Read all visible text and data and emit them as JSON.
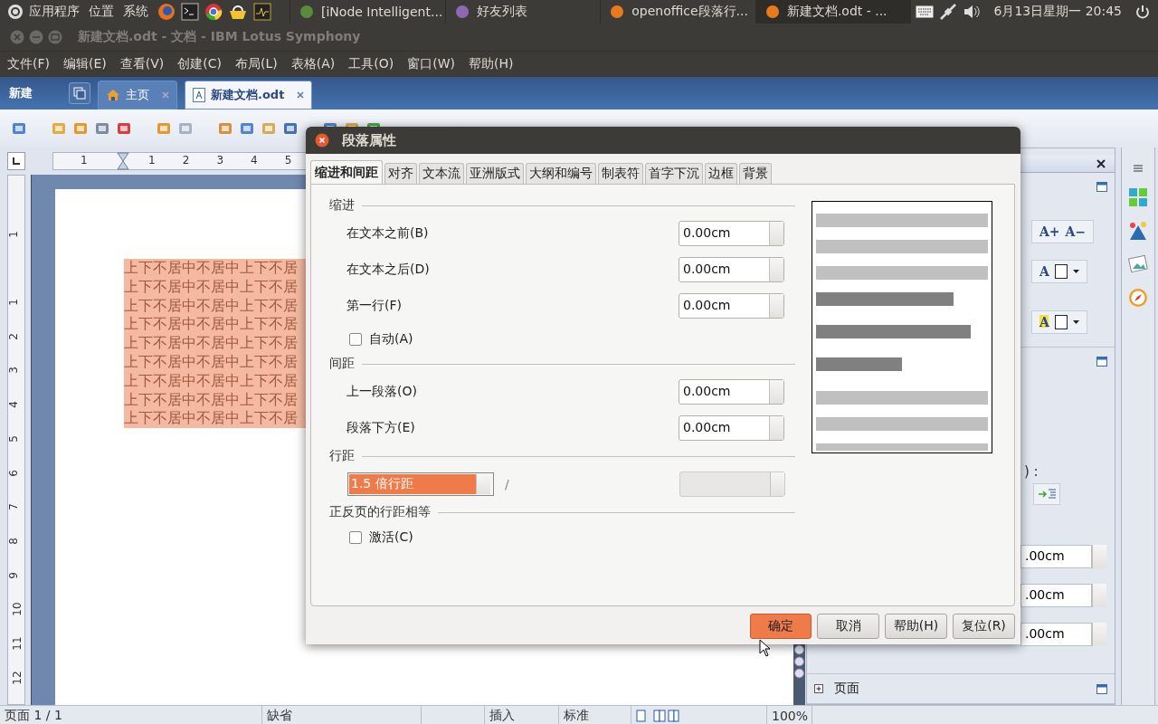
{
  "top_panel": {
    "menus": [
      "应用程序",
      "位置",
      "系统"
    ],
    "tasks": [
      {
        "label": "[iNode Intelligent...",
        "selected": false
      },
      {
        "label": "好友列表",
        "selected": false
      },
      {
        "label": "openoffice段落行...",
        "selected": false
      },
      {
        "label": "新建文档.odt - ...",
        "selected": true
      }
    ],
    "clock": "6月13日星期一 20:45"
  },
  "window": {
    "title": "新建文档.odt - 文档 - IBM Lotus Symphony"
  },
  "menu": [
    "文件(F)",
    "编辑(E)",
    "查看(V)",
    "创建(C)",
    "布局(L)",
    "表格(A)",
    "工具(O)",
    "窗口(W)",
    "帮助(H)"
  ],
  "doc_tabs": {
    "new_label": "新建",
    "tabs": [
      {
        "label": "主页",
        "selected": false
      },
      {
        "label": "新建文档.odt",
        "selected": true
      }
    ]
  },
  "ruler": {
    "horizontal": [
      "1",
      "1",
      "2",
      "3",
      "4",
      "5"
    ],
    "vertical": [
      "1",
      "1",
      "2",
      "3",
      "4",
      "5",
      "6",
      "7",
      "8",
      "9",
      "10",
      "11",
      "12"
    ]
  },
  "document": {
    "lines": [
      "上下不居中不居中上下不居",
      "上下不居中不居中上下不居",
      "上下不居中不居中上下不居",
      "上下不居中不居中上下不居",
      "上下不居中不居中上下不居",
      "上下不居中不居中上下不居",
      "上下不居中不居中上下不居",
      "上下不居中不居中上下不居",
      "上下不居中不居中上下不居"
    ]
  },
  "sidebar": {
    "label_fragment": ") :",
    "grow": "A+",
    "shrink": "A−",
    "font_color": "A",
    "highlight": "A",
    "fields": [
      ".00cm",
      ".00cm",
      ".00cm"
    ],
    "section": "页面"
  },
  "dialog": {
    "title": "段落属性",
    "tabs": [
      {
        "label": "缩进和间距",
        "selected": true
      },
      {
        "label": "对齐",
        "selected": false
      },
      {
        "label": "文本流",
        "selected": false
      },
      {
        "label": "亚洲版式",
        "selected": false
      },
      {
        "label": "大纲和编号",
        "selected": false
      },
      {
        "label": "制表符",
        "selected": false
      },
      {
        "label": "首字下沉",
        "selected": false
      },
      {
        "label": "边框",
        "selected": false
      },
      {
        "label": "背景",
        "selected": false
      }
    ],
    "sections": [
      {
        "heading": "缩进",
        "rows": [
          {
            "kind": "spin",
            "label": "在文本之前(B)",
            "value": "0.00cm"
          },
          {
            "kind": "spin",
            "label": "在文本之后(D)",
            "value": "0.00cm"
          },
          {
            "kind": "spin",
            "label": "第一行(F)",
            "value": "0.00cm"
          },
          {
            "kind": "check",
            "label": "自动(A)",
            "checked": false
          }
        ]
      },
      {
        "heading": "间距",
        "rows": [
          {
            "kind": "spin",
            "label": "上一段落(O)",
            "value": "0.00cm"
          },
          {
            "kind": "spin",
            "label": "段落下方(E)",
            "value": "0.00cm"
          }
        ]
      },
      {
        "heading": "行距",
        "rows": [
          {
            "kind": "linespacing",
            "value": "1.5 倍行距",
            "separator": "/",
            "disabled": true
          }
        ]
      },
      {
        "heading": "正反页的行距相等",
        "rows": [
          {
            "kind": "check",
            "label": "激活(C)",
            "checked": false
          }
        ]
      }
    ],
    "buttons": [
      {
        "label": "确定",
        "primary": true
      },
      {
        "label": "取消",
        "primary": false
      },
      {
        "label": "帮助(H)",
        "primary": false
      },
      {
        "label": "复位(R)",
        "primary": false
      }
    ]
  },
  "status_bar": {
    "page": "页面 1 / 1",
    "style": "缺省",
    "mode": "插入",
    "selection": "标准",
    "zoom": "100%"
  }
}
